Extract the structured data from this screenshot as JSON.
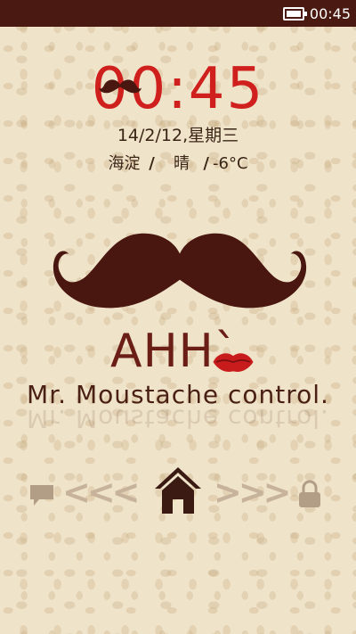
{
  "status_bar": {
    "time": "00:45"
  },
  "lockscreen": {
    "clock": "00:45",
    "date": "14/2/12,星期三",
    "weather": {
      "location": "海淀",
      "separator": "/",
      "condition": "晴",
      "temperature": "-6°C"
    },
    "headline": "AHH`",
    "tagline": "Mr. Moustache control.",
    "unlock": {
      "left_arrows": "<<<",
      "right_arrows": ">>>"
    }
  },
  "icons": [
    "battery-icon",
    "mustache-icon",
    "lips-icon",
    "chat-icon",
    "home-icon",
    "lock-icon"
  ],
  "colors": {
    "status_bar": "#4a1a12",
    "clock": "#d0201e",
    "mustache": "#4a1610",
    "background": "#efe3c9",
    "arrows": "#c7b39c"
  }
}
